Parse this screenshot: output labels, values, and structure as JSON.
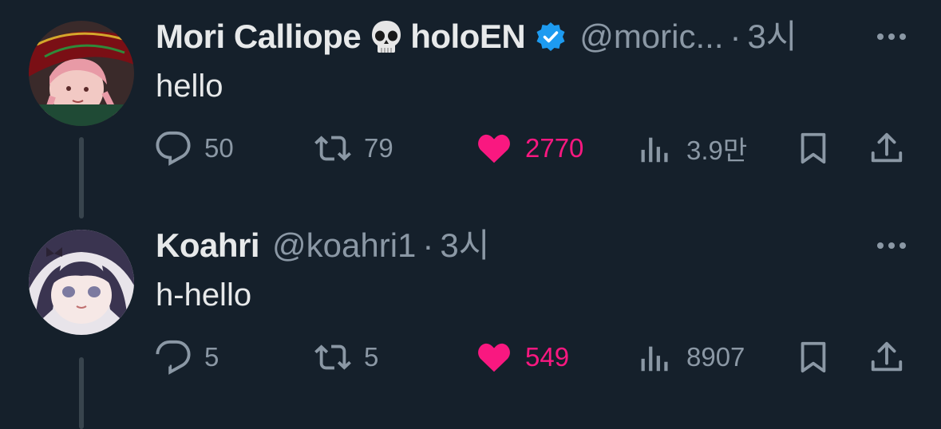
{
  "tweets": [
    {
      "display_name": "Mori Calliope",
      "name_suffix": "holoEN",
      "name_emoji": "skull-icon",
      "verified": true,
      "handle": "@moric...",
      "separator": "·",
      "time": "3시",
      "text": "hello",
      "replies": "50",
      "retweets": "79",
      "likes": "2770",
      "views": "3.9만",
      "liked": true
    },
    {
      "display_name": "Koahri",
      "handle": "@koahri1",
      "separator": "·",
      "time": "3시",
      "text": "h-hello",
      "replies": "5",
      "retweets": "5",
      "likes": "549",
      "views": "8907",
      "liked": true
    }
  ],
  "colors": {
    "background": "#15202b",
    "primary_text": "#e7e9ea",
    "secondary_text": "#8b98a5",
    "like_pink": "#f91880",
    "verified_blue": "#1d9bf0",
    "thread_line": "#38444d"
  }
}
